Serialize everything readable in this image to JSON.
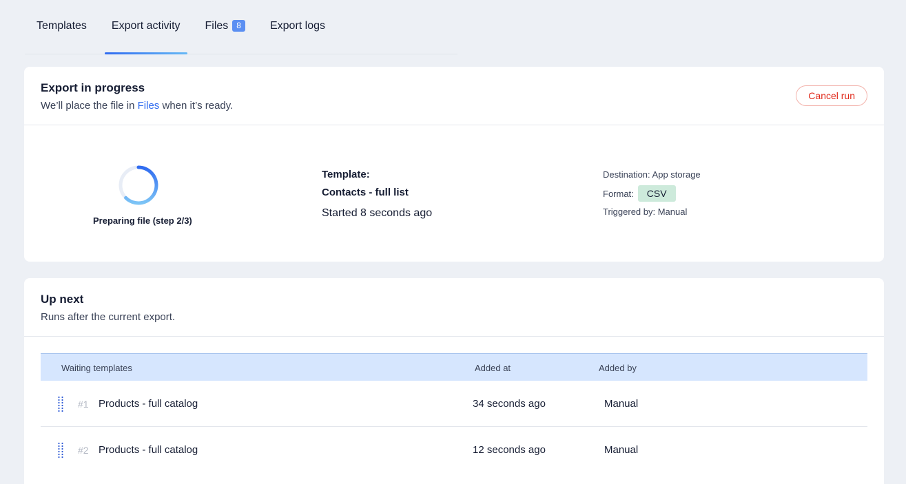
{
  "tabs": [
    {
      "label": "Templates"
    },
    {
      "label": "Export activity"
    },
    {
      "label": "Files",
      "badge": "8"
    },
    {
      "label": "Export logs"
    }
  ],
  "progress": {
    "title": "Export in progress",
    "subtitle_before": "We’ll place the file in",
    "subtitle_link": "Files",
    "subtitle_after": "when it’s ready.",
    "cancel_label": "Cancel run",
    "status": "Preparing file (step 2/3)",
    "template_label": "Template:",
    "template_name": "Contacts - full list",
    "started": "Started 8 seconds ago",
    "destination": "Destination: App storage",
    "format_label": "Format:",
    "format_value": "CSV",
    "triggered": "Triggered by: Manual"
  },
  "upnext": {
    "title": "Up next",
    "subtitle": "Runs after the current export.",
    "columns": {
      "name": "Waiting templates",
      "added_at": "Added at",
      "added_by": "Added by"
    },
    "rows": [
      {
        "rank": "#1",
        "name": "Products - full catalog",
        "added_at": "34 seconds ago",
        "added_by": "Manual"
      },
      {
        "rank": "#2",
        "name": "Products - full catalog",
        "added_at": "12 seconds ago",
        "added_by": "Manual"
      }
    ]
  },
  "colors": {
    "accent": "#2f6bf0",
    "danger": "#e0291a",
    "table_header": "#d6e6fe",
    "csv_chip": "#cdeadb"
  }
}
